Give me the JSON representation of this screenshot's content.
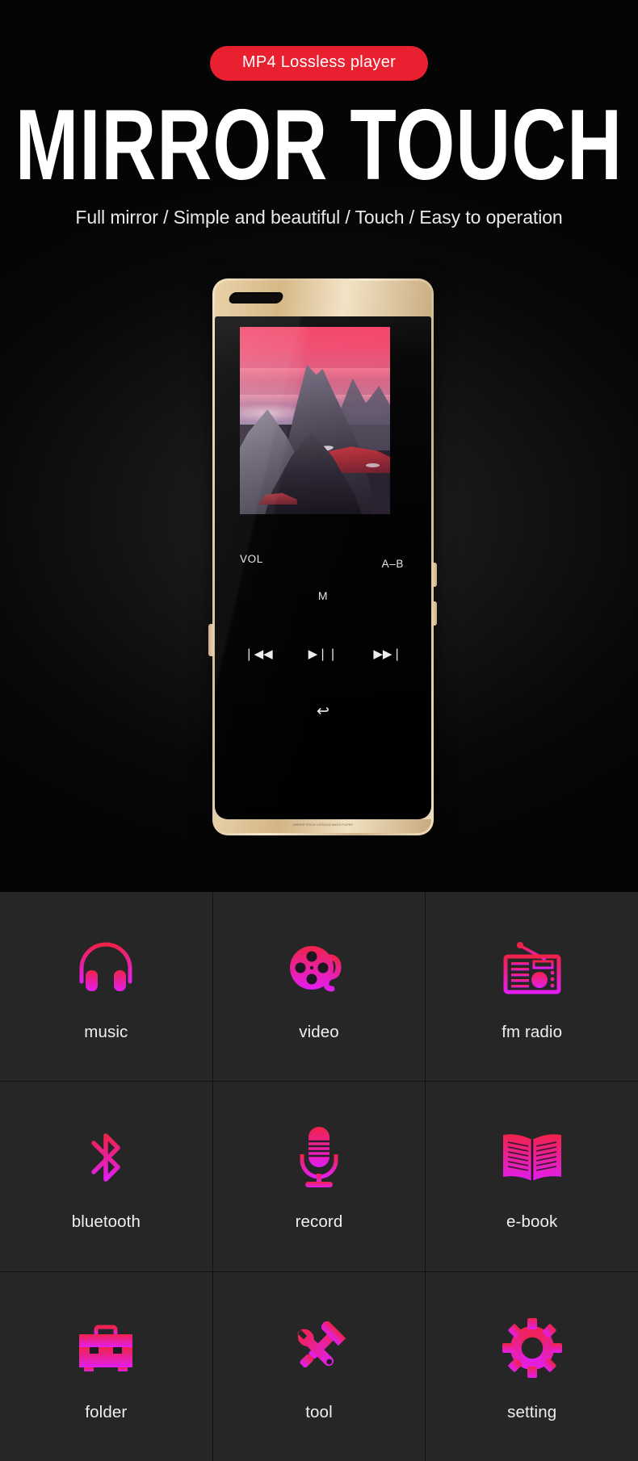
{
  "hero": {
    "badge": "MP4 Lossless player",
    "headline": "MIRROR TOUCH",
    "subtitle": "Full mirror / Simple and beautiful / Touch / Easy to operation",
    "badge_color": "#e8202f",
    "headline_color": "#ffffff",
    "background_color": "#050505"
  },
  "device": {
    "controls": {
      "vol": "VOL",
      "ab": "A–B",
      "menu": "M",
      "previous": "❘◀◀",
      "play_pause": "▶❘❘",
      "next": "▶▶❘",
      "back": "↩"
    },
    "bottom_text": "MIRROR TOUCH LOSSLESS MUSIC PLAYER",
    "body_color": "#e0c59a",
    "screen_color": "#000000"
  },
  "features": {
    "icon_gradient_top": "#f0224a",
    "icon_gradient_bottom": "#e21ef0",
    "cell_color": "#262627",
    "items": [
      {
        "icon": "headphones-icon",
        "label": "music"
      },
      {
        "icon": "film-reel-icon",
        "label": "video"
      },
      {
        "icon": "radio-icon",
        "label": "fm radio"
      },
      {
        "icon": "bluetooth-icon",
        "label": "bluetooth"
      },
      {
        "icon": "microphone-icon",
        "label": "record"
      },
      {
        "icon": "open-book-icon",
        "label": "e-book"
      },
      {
        "icon": "toolbox-icon",
        "label": "folder"
      },
      {
        "icon": "hammer-wrench-icon",
        "label": "tool"
      },
      {
        "icon": "gear-icon",
        "label": "setting"
      }
    ]
  }
}
